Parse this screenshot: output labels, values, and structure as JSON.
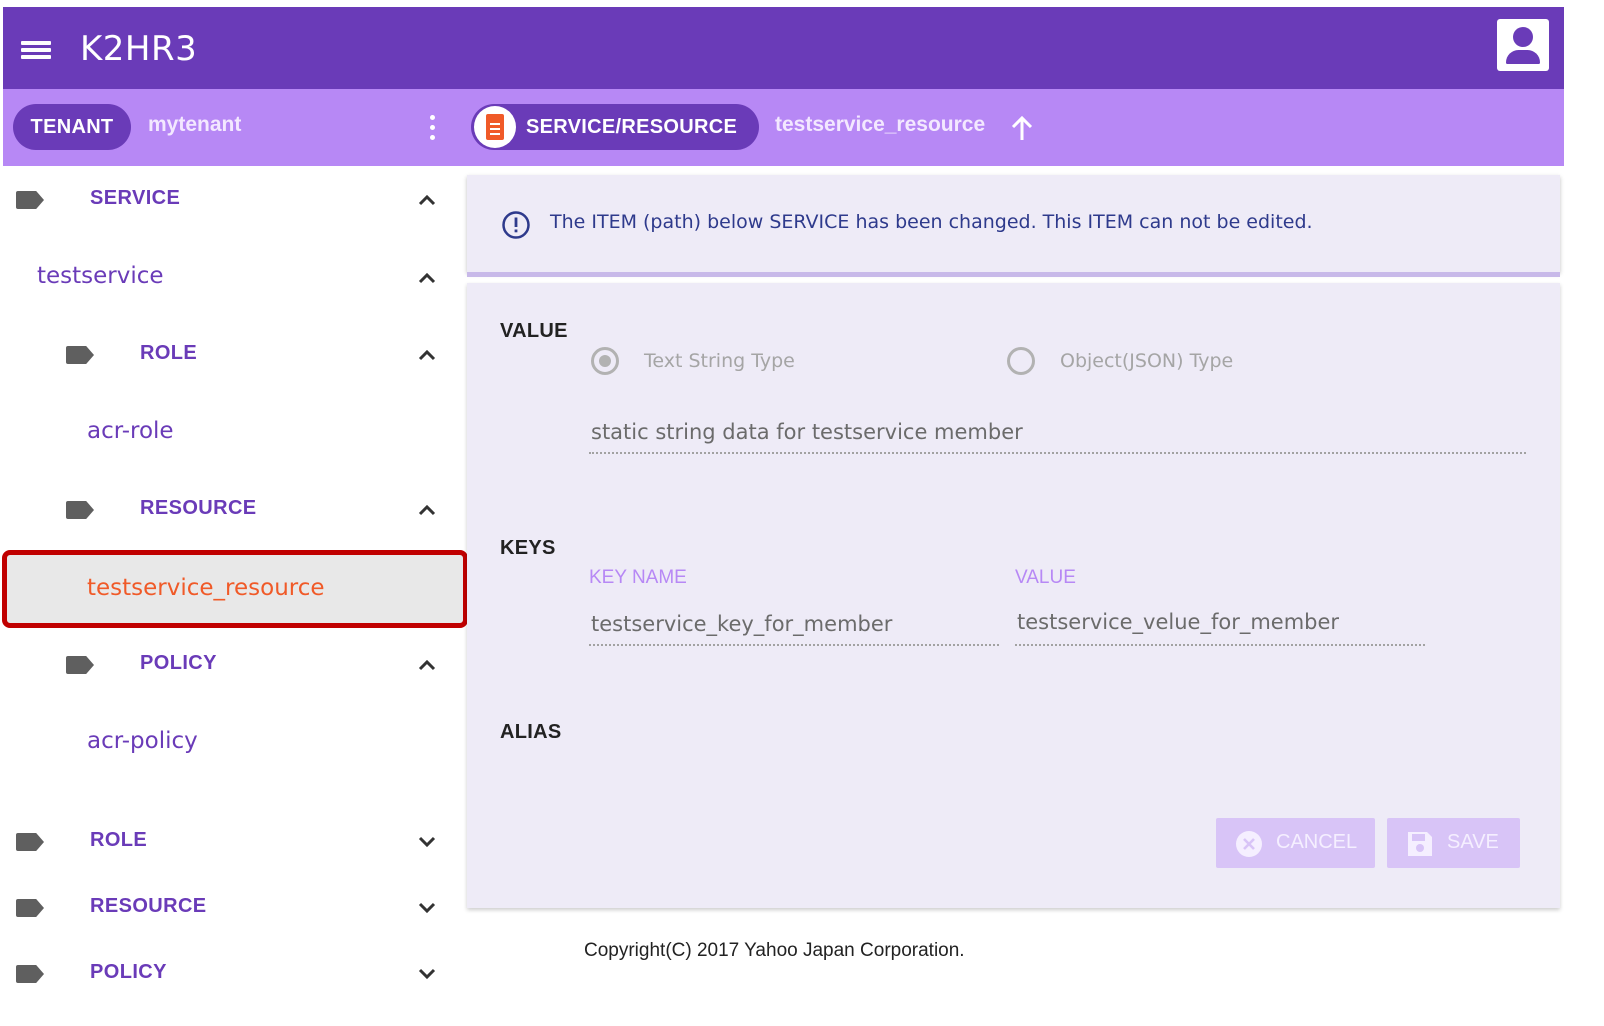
{
  "appbar": {
    "title": "K2HR3",
    "menu_icon": "menu-icon",
    "account_icon": "account-icon",
    "brand_color": "#6a3bb8"
  },
  "subbar": {
    "tenant_chip": "TENANT",
    "tenant_name": "mytenant",
    "service_chip": "SERVICE/RESOURCE",
    "resource_name": "testservice_resource",
    "bar_color": "#b788f5"
  },
  "sidebar": {
    "service_label": "SERVICE",
    "testservice": "testservice",
    "role_label": "ROLE",
    "acr_role": "acr-role",
    "resource_label": "RESOURCE",
    "selected_resource": "testservice_resource",
    "policy_label": "POLICY",
    "acr_policy": "acr-policy",
    "top_role": "ROLE",
    "top_resource": "RESOURCE",
    "top_policy": "POLICY",
    "selected_color": "#f05a28"
  },
  "alert": {
    "message": "The ITEM (path) below SERVICE has been changed. This ITEM can not be edited."
  },
  "form": {
    "value_section": "VALUE",
    "radio_text": "Text String Type",
    "radio_json": "Object(JSON) Type",
    "selected_type": "Text String Type",
    "value_text": "static string data for testservice member",
    "keys_section": "KEYS",
    "key_name_header": "KEY NAME",
    "key_value_header": "VALUE",
    "key_name": "testservice_key_for_member",
    "key_value": "testservice_velue_for_member",
    "alias_section": "ALIAS",
    "cancel_label": "CANCEL",
    "save_label": "SAVE"
  },
  "footer": {
    "copyright": "Copyright(C) 2017 Yahoo Japan Corporation."
  }
}
